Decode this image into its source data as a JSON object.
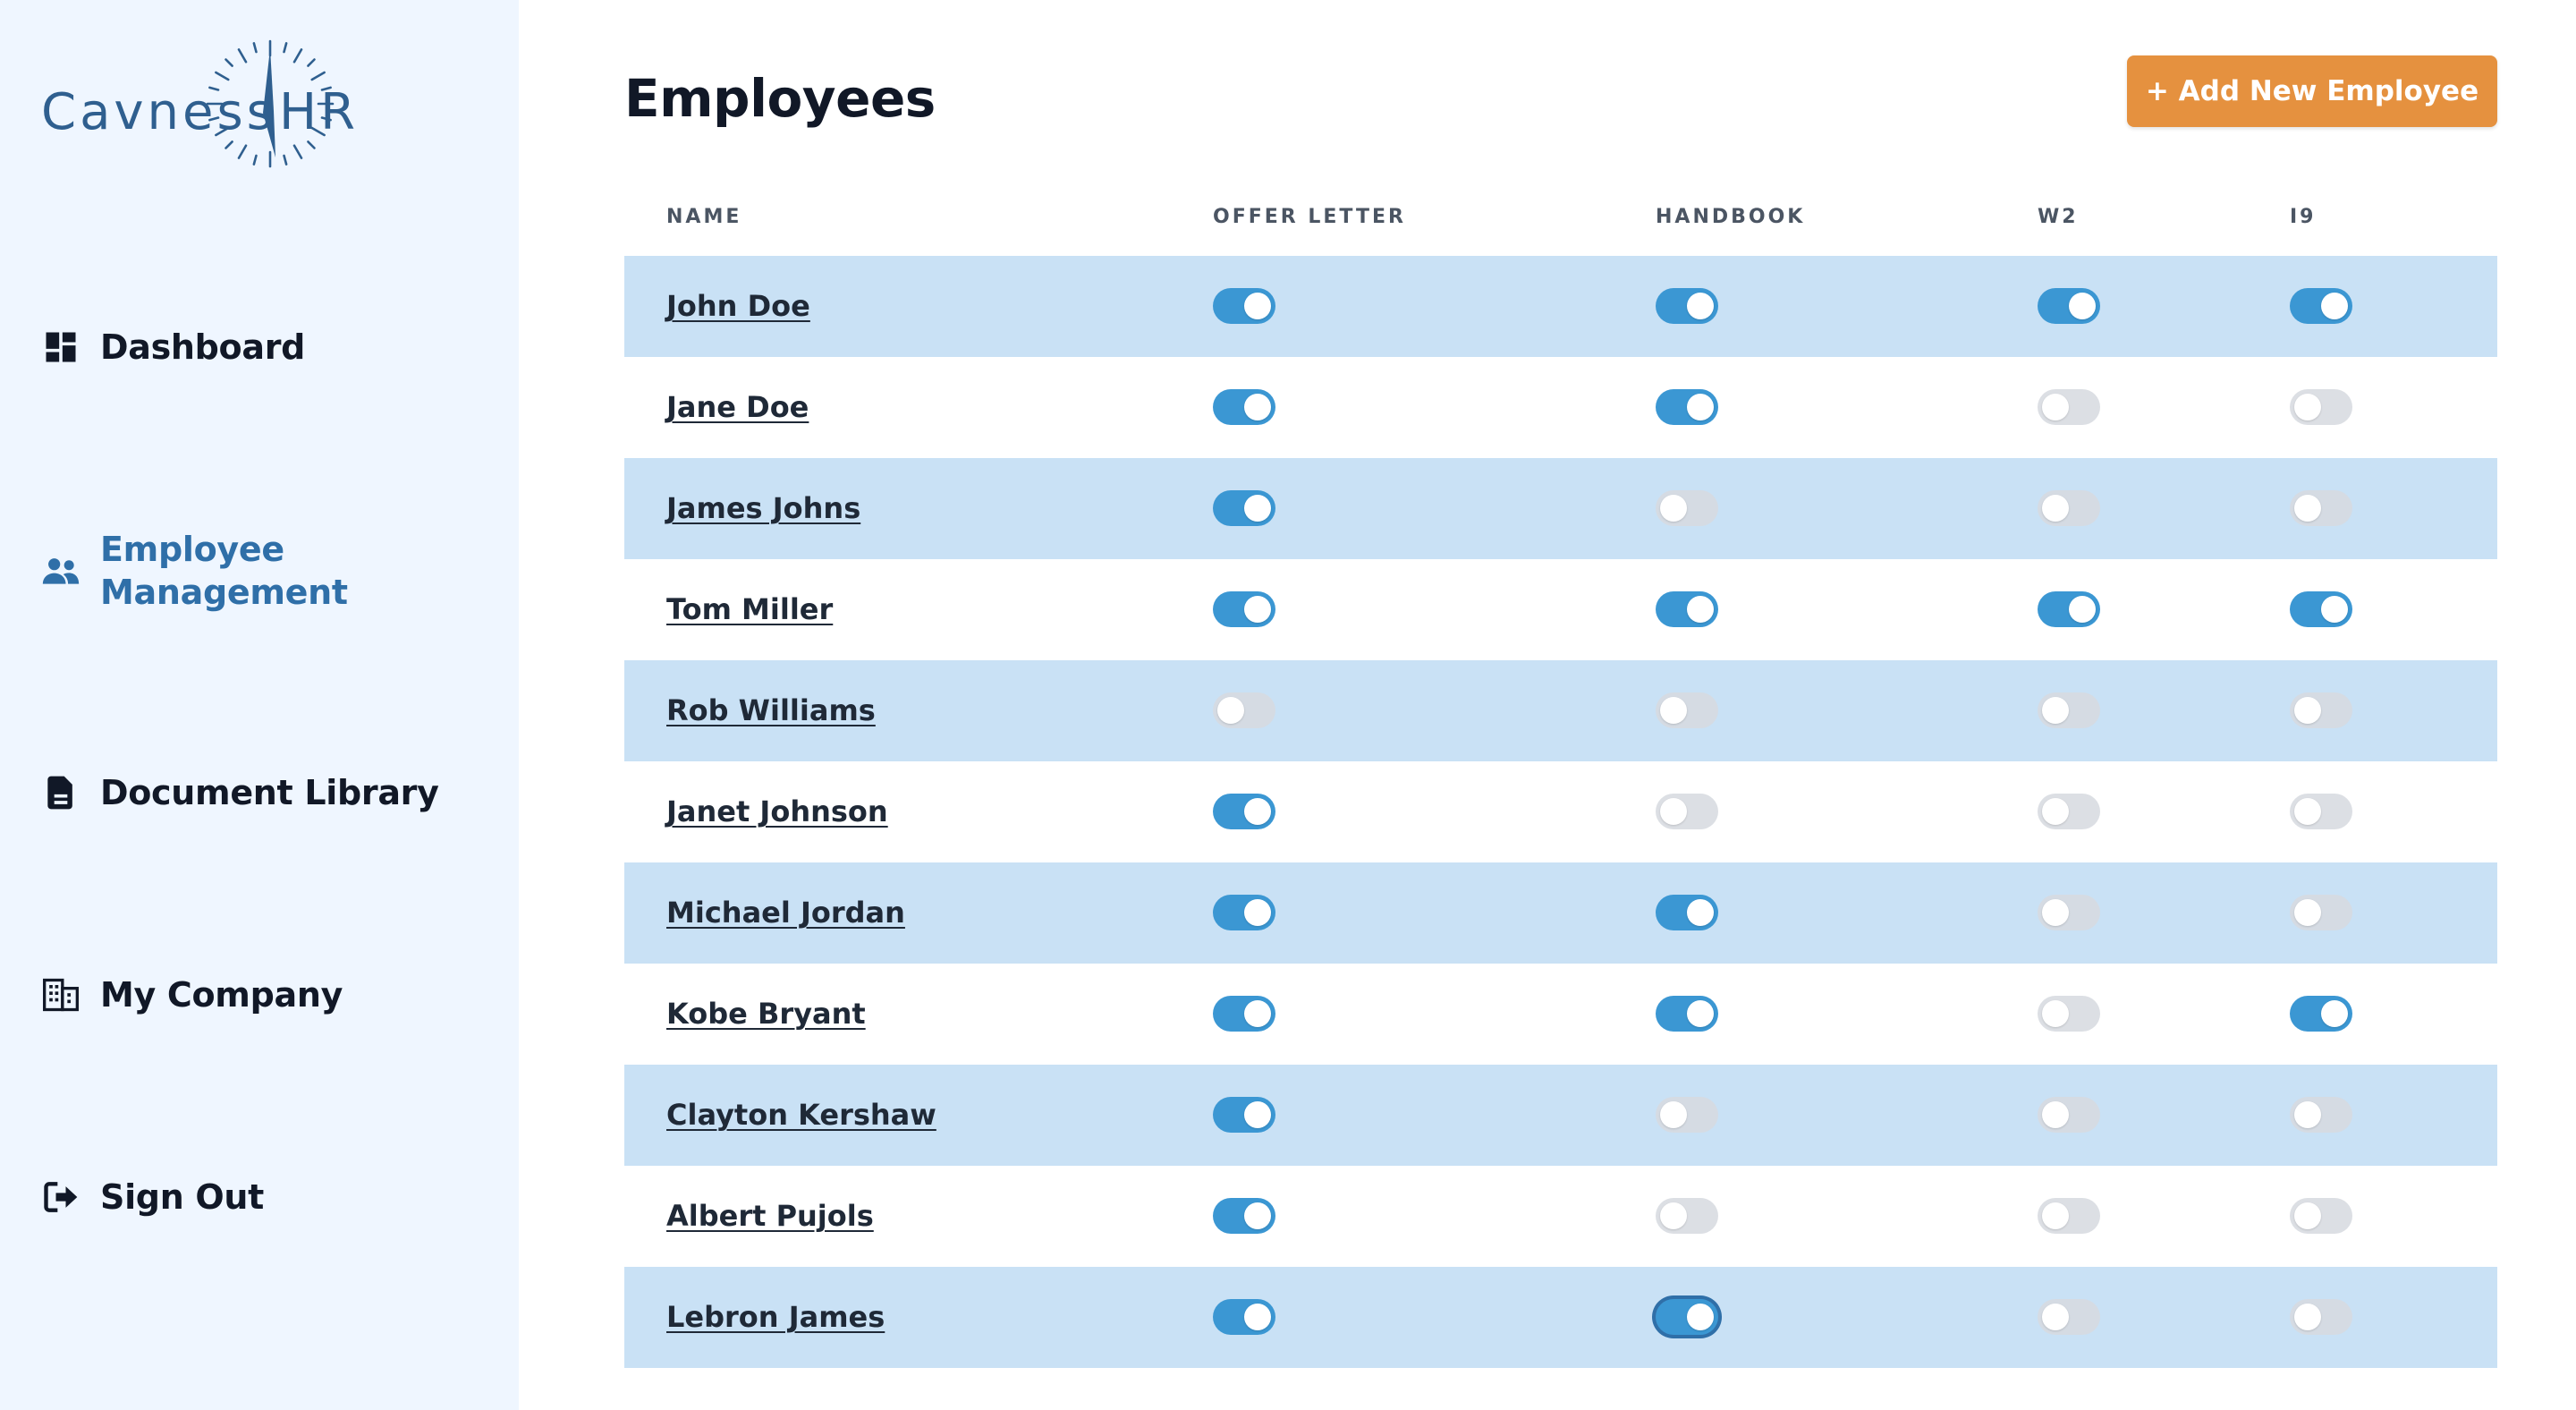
{
  "brand": {
    "logo_text_left": "Cavness",
    "logo_text_right": "HR",
    "logo_icon": "clock-compass-icon",
    "color": "#2f5f8f"
  },
  "sidebar": {
    "items": [
      {
        "label": "Dashboard",
        "icon": "dashboard-icon",
        "active": false
      },
      {
        "label": "Employee Management",
        "icon": "users-icon",
        "active": true
      },
      {
        "label": "Document Library",
        "icon": "document-icon",
        "active": false
      },
      {
        "label": "My Company",
        "icon": "building-icon",
        "active": false
      },
      {
        "label": "Sign Out",
        "icon": "sign-out-icon",
        "active": false
      }
    ]
  },
  "header": {
    "title": "Employees",
    "add_button_label": "+ Add New Employee"
  },
  "colors": {
    "accent": "#e5913f",
    "toggle_on": "#3b97d3",
    "row_stripe": "#c9e1f5",
    "active_nav": "#2f6fa8"
  },
  "table": {
    "columns": [
      "NAME",
      "OFFER LETTER",
      "HANDBOOK",
      "W2",
      "I9"
    ],
    "rows": [
      {
        "name": "John Doe",
        "offer_letter": true,
        "handbook": true,
        "w2": true,
        "i9": true
      },
      {
        "name": "Jane Doe",
        "offer_letter": true,
        "handbook": true,
        "w2": false,
        "i9": false
      },
      {
        "name": "James Johns",
        "offer_letter": true,
        "handbook": false,
        "w2": false,
        "i9": false
      },
      {
        "name": "Tom Miller",
        "offer_letter": true,
        "handbook": true,
        "w2": true,
        "i9": true
      },
      {
        "name": "Rob Williams",
        "offer_letter": false,
        "handbook": false,
        "w2": false,
        "i9": false
      },
      {
        "name": "Janet Johnson",
        "offer_letter": true,
        "handbook": false,
        "w2": false,
        "i9": false
      },
      {
        "name": "Michael Jordan",
        "offer_letter": true,
        "handbook": true,
        "w2": false,
        "i9": false
      },
      {
        "name": "Kobe Bryant",
        "offer_letter": true,
        "handbook": true,
        "w2": false,
        "i9": true
      },
      {
        "name": "Clayton Kershaw",
        "offer_letter": true,
        "handbook": false,
        "w2": false,
        "i9": false
      },
      {
        "name": "Albert Pujols",
        "offer_letter": true,
        "handbook": false,
        "w2": false,
        "i9": false
      },
      {
        "name": "Lebron James",
        "offer_letter": true,
        "handbook": true,
        "w2": false,
        "i9": false
      }
    ]
  }
}
